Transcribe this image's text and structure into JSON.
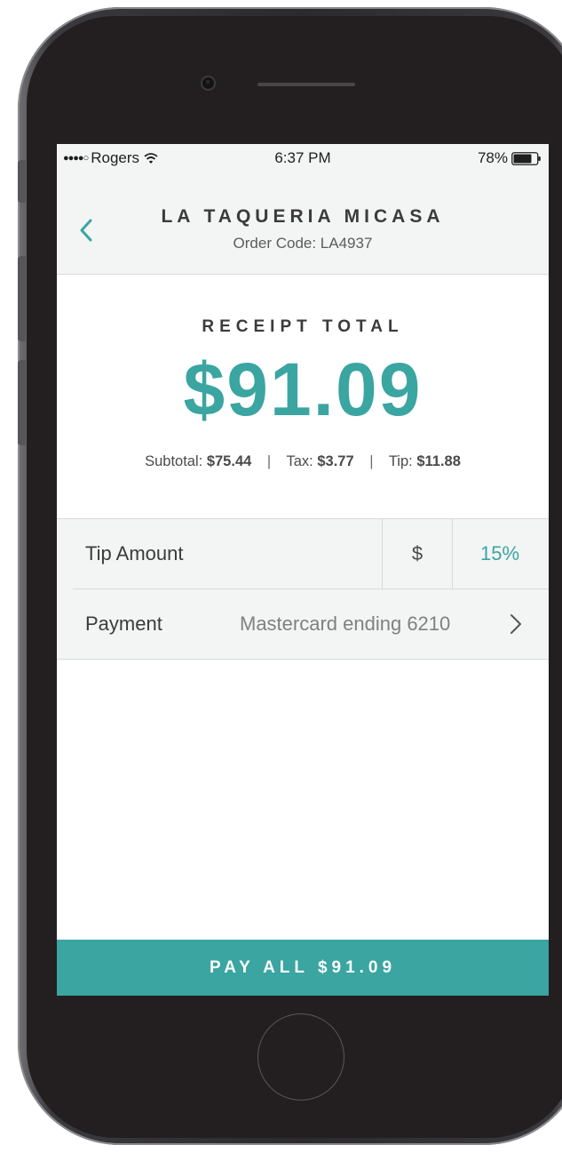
{
  "status_bar": {
    "carrier": "Rogers",
    "time": "6:37 PM",
    "battery": "78%"
  },
  "header": {
    "restaurant": "LA TAQUERIA MICASA",
    "order_code": "Order Code: LA4937"
  },
  "receipt": {
    "label": "RECEIPT TOTAL",
    "total": "$91.09",
    "subtotal_label": "Subtotal:",
    "subtotal": "$75.44",
    "tax_label": "Tax:",
    "tax": "$3.77",
    "tip_label": "Tip:",
    "tip": "$11.88",
    "separator": "|"
  },
  "tip_row": {
    "label": "Tip Amount",
    "dollar_option": "$",
    "percent_option": "15%"
  },
  "payment_row": {
    "label": "Payment",
    "method": "Mastercard ending 6210"
  },
  "pay_button": {
    "label": "PAY ALL $91.09"
  },
  "colors": {
    "accent": "#3aa5a1",
    "header_bg": "#f3f4f4",
    "text_dark": "#3b3b3d"
  },
  "icons": [
    "back-chevron-icon",
    "wifi-icon",
    "battery-icon",
    "chevron-right-icon"
  ]
}
